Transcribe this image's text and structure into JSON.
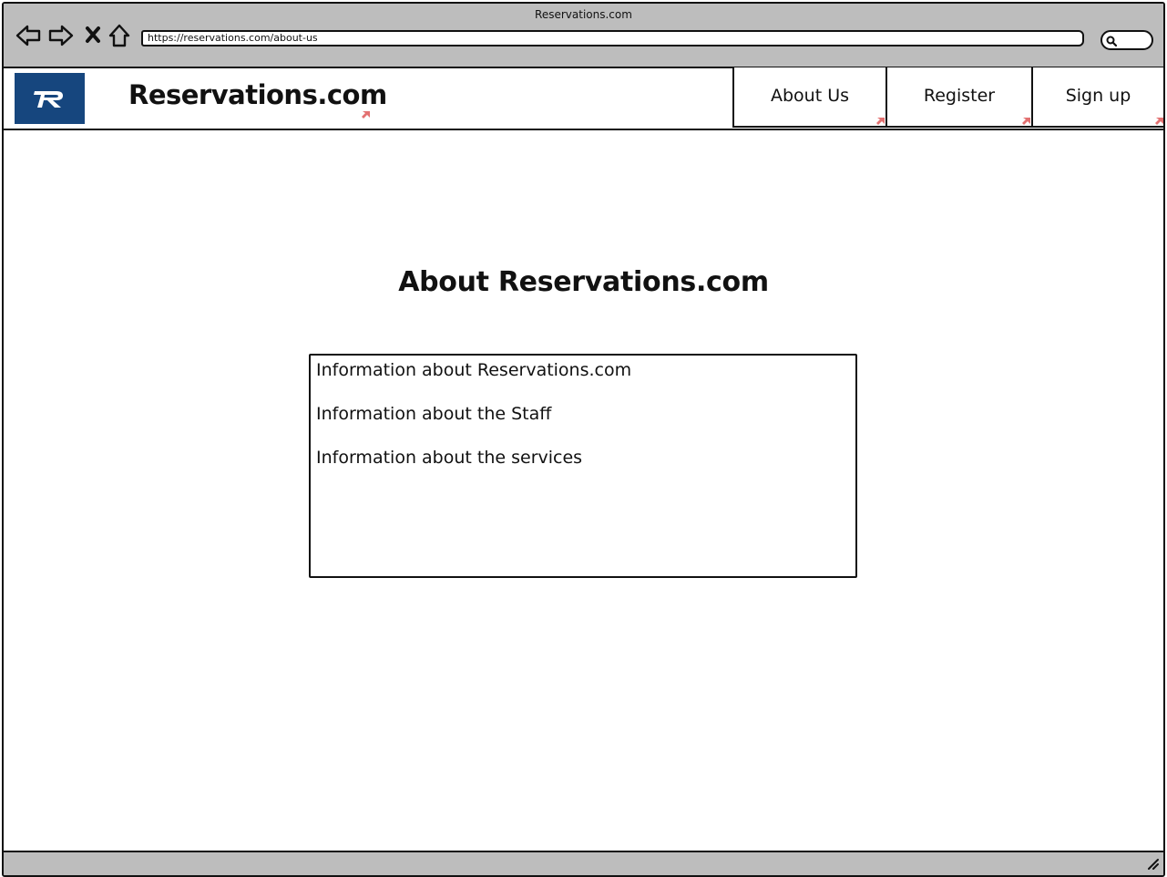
{
  "browser": {
    "window_title": "Reservations.com",
    "url": "https://reservations.com/about-us",
    "nav_icons": [
      "back-arrow-icon",
      "forward-arrow-icon",
      "close-icon",
      "home-icon"
    ],
    "search_icon": "search-icon"
  },
  "header": {
    "logo_icon": "reservations-logo",
    "brand": "Reservations.com",
    "nav": [
      {
        "label": "About Us"
      },
      {
        "label": "Register"
      },
      {
        "label": "Sign up"
      }
    ]
  },
  "main": {
    "heading": "About Reservations.com",
    "info_lines": [
      "Information about Reservations.com",
      "Information about the Staff",
      "Information about the services"
    ]
  },
  "colors": {
    "chrome": "#bdbdbd",
    "logo_bg": "#16467e",
    "link_marker": "#e37171"
  }
}
